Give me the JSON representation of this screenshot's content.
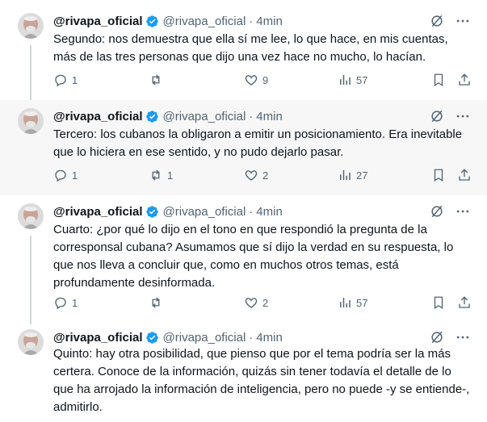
{
  "author": {
    "name": "@rivapa_oficial",
    "handle": "@rivapa_oficial",
    "verified_color": "#1d9bf0"
  },
  "separator": "·",
  "tweets": [
    {
      "time": "4min",
      "text": "Segundo:  nos demuestra  que ella sí me lee, lo que hace, en mis cuentas, más de las tres personas que dijo una vez hace no mucho, lo hacían.",
      "replies": "1",
      "retweets": "",
      "likes": "9",
      "views": "57"
    },
    {
      "time": "4min",
      "text": "Tercero:  los cubanos la obligaron a emitir un posicionamiento. Era inevitable que lo hiciera en ese sentido, y no pudo dejarlo pasar.",
      "replies": "1",
      "retweets": "1",
      "likes": "2",
      "views": "27"
    },
    {
      "time": "4min",
      "text": "Cuarto: ¿por qué lo dijo en el tono en que respondió la pregunta de la corresponsal cubana? Asumamos que sí dijo la verdad en su respuesta, lo que nos lleva a concluir que, como en muchos otros temas, está profundamente desinformada.",
      "replies": "1",
      "retweets": "",
      "likes": "2",
      "views": "57"
    },
    {
      "time": "4min",
      "text": "Quinto: hay otra posibilidad, que pienso que por el tema podría ser la más certera. Conoce de la información, quizás sin tener todavía el detalle de lo que ha arrojado la información de inteligencia, pero no puede -y se entiende-, admitirlo."
    }
  ],
  "icons": {
    "reply": "reply-icon",
    "retweet": "retweet-icon",
    "like": "heart-icon",
    "views": "views-icon",
    "bookmark": "bookmark-icon",
    "share": "share-icon",
    "grok": "grok-icon",
    "more": "more-icon"
  }
}
